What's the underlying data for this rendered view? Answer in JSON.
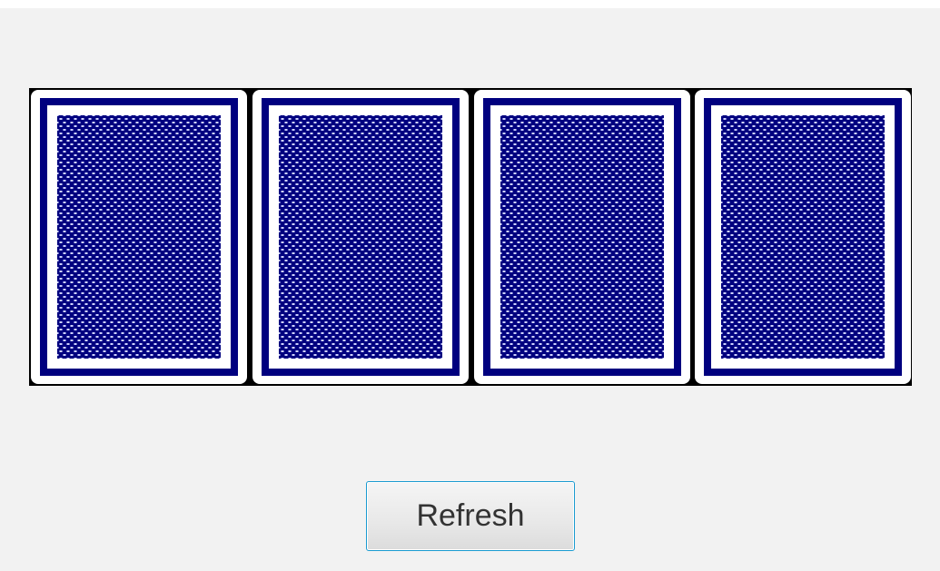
{
  "window": {
    "cards": [
      {
        "face": "back",
        "pattern": "blue-crosshatch"
      },
      {
        "face": "back",
        "pattern": "blue-crosshatch"
      },
      {
        "face": "back",
        "pattern": "blue-crosshatch"
      },
      {
        "face": "back",
        "pattern": "blue-crosshatch"
      }
    ],
    "refresh_label": "Refresh"
  },
  "colors": {
    "background": "#f2f2f2",
    "card_back": "#00007f",
    "button_border": "#1a9bd1"
  }
}
